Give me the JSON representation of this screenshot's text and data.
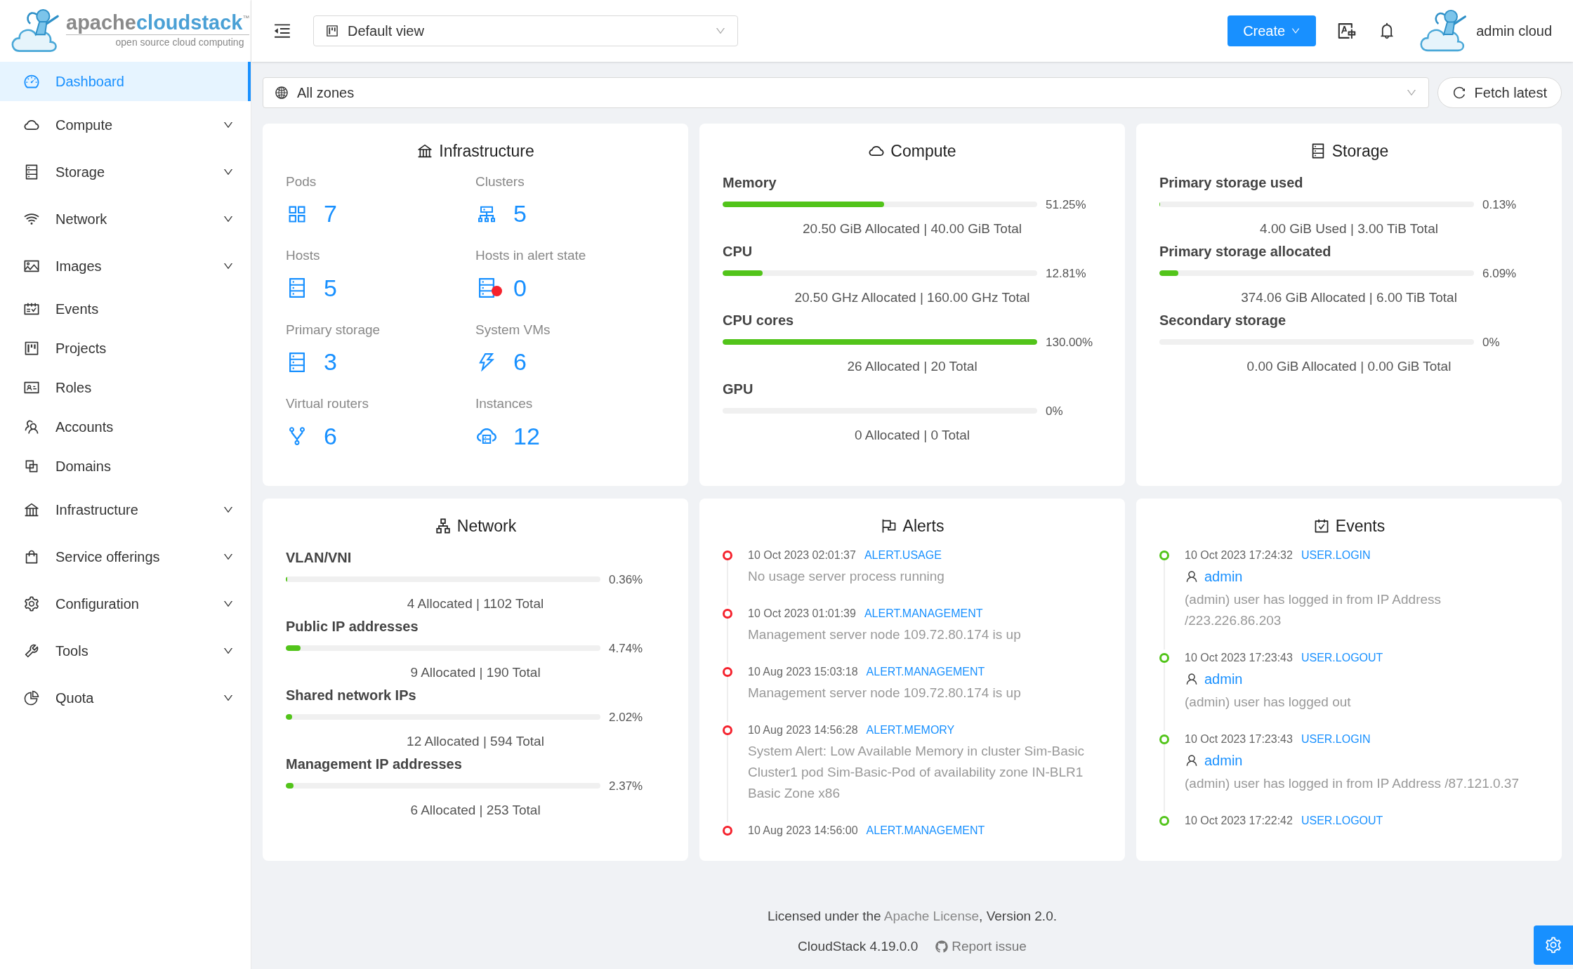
{
  "logo": {
    "part_1": "apache",
    "part_2": "cloudstack",
    "trademark": "™",
    "tagline": "open source cloud computing"
  },
  "header": {
    "view_select": "Default view",
    "create_button": "Create",
    "user": "admin cloud"
  },
  "sidebar": {
    "items": [
      {
        "label": "Dashboard",
        "selected": true,
        "expandable": false
      },
      {
        "label": "Compute",
        "selected": false,
        "expandable": true
      },
      {
        "label": "Storage",
        "selected": false,
        "expandable": true
      },
      {
        "label": "Network",
        "selected": false,
        "expandable": true
      },
      {
        "label": "Images",
        "selected": false,
        "expandable": true
      },
      {
        "label": "Events",
        "selected": false,
        "expandable": false
      },
      {
        "label": "Projects",
        "selected": false,
        "expandable": false
      },
      {
        "label": "Roles",
        "selected": false,
        "expandable": false
      },
      {
        "label": "Accounts",
        "selected": false,
        "expandable": false
      },
      {
        "label": "Domains",
        "selected": false,
        "expandable": false
      },
      {
        "label": "Infrastructure",
        "selected": false,
        "expandable": true
      },
      {
        "label": "Service offerings",
        "selected": false,
        "expandable": true
      },
      {
        "label": "Configuration",
        "selected": false,
        "expandable": true
      },
      {
        "label": "Tools",
        "selected": false,
        "expandable": true
      },
      {
        "label": "Quota",
        "selected": false,
        "expandable": true
      }
    ]
  },
  "zone_select": "All zones",
  "fetch_button": "Fetch latest",
  "infrastructure": {
    "title": "Infrastructure",
    "stats": [
      {
        "label": "Pods",
        "value": "7",
        "alert": false
      },
      {
        "label": "Clusters",
        "value": "5",
        "alert": false
      },
      {
        "label": "Hosts",
        "value": "5",
        "alert": false
      },
      {
        "label": "Hosts in alert state",
        "value": "0",
        "alert": true
      },
      {
        "label": "Primary storage",
        "value": "3",
        "alert": false
      },
      {
        "label": "System VMs",
        "value": "6",
        "alert": false
      },
      {
        "label": "Virtual routers",
        "value": "6",
        "alert": false
      },
      {
        "label": "Instances",
        "value": "12",
        "alert": false
      }
    ]
  },
  "compute": {
    "title": "Compute",
    "meters": [
      {
        "name": "Memory",
        "level": 0.5125,
        "reading": "51.25%",
        "detail": "20.50 GiB Allocated | 40.00 GiB Total"
      },
      {
        "name": "CPU",
        "level": 0.1281,
        "reading": "12.81%",
        "detail": "20.50 GHz Allocated | 160.00 GHz Total"
      },
      {
        "name": "CPU cores",
        "level": 1,
        "reading": "130.00%",
        "detail": "26 Allocated | 20 Total"
      },
      {
        "name": "GPU",
        "level": 0,
        "reading": "0%",
        "detail": "0 Allocated | 0 Total"
      }
    ]
  },
  "storage": {
    "title": "Storage",
    "meters": [
      {
        "name": "Primary storage used",
        "level": 0.0013,
        "reading": "0.13%",
        "detail": "4.00 GiB Used | 3.00 TiB Total"
      },
      {
        "name": "Primary storage allocated",
        "level": 0.0609,
        "reading": "6.09%",
        "detail": "374.06 GiB Allocated | 6.00 TiB Total"
      },
      {
        "name": "Secondary storage",
        "level": 0,
        "reading": "0%",
        "detail": "0.00 GiB Allocated | 0.00 GiB Total"
      }
    ]
  },
  "network": {
    "title": "Network",
    "meters": [
      {
        "name": "VLAN/VNI",
        "level": 0.0036,
        "reading": "0.36%",
        "detail": "4 Allocated | 1102 Total"
      },
      {
        "name": "Public IP addresses",
        "level": 0.0474,
        "reading": "4.74%",
        "detail": "9 Allocated | 190 Total"
      },
      {
        "name": "Shared network IPs",
        "level": 0.0202,
        "reading": "2.02%",
        "detail": "12 Allocated | 594 Total"
      },
      {
        "name": "Management IP addresses",
        "level": 0.0237,
        "reading": "2.37%",
        "detail": "6 Allocated | 253 Total"
      }
    ]
  },
  "alerts": {
    "title": "Alerts",
    "items": [
      {
        "time": "10 Oct 2023 02:01:37",
        "type": "ALERT.USAGE",
        "message": "No usage server process running"
      },
      {
        "time": "10 Oct 2023 01:01:39",
        "type": "ALERT.MANAGEMENT",
        "message": "Management server node 109.72.80.174 is up"
      },
      {
        "time": "10 Aug 2023 15:03:18",
        "type": "ALERT.MANAGEMENT",
        "message": "Management server node 109.72.80.174 is up"
      },
      {
        "time": "10 Aug 2023 14:56:28",
        "type": "ALERT.MEMORY",
        "message": "System Alert: Low Available Memory in cluster Sim-Basic Cluster1 pod Sim-Basic-Pod of availability zone IN-BLR1 Basic Zone x86"
      },
      {
        "time": "10 Aug 2023 14:56:00",
        "type": "ALERT.MANAGEMENT"
      }
    ]
  },
  "events": {
    "title": "Events",
    "items": [
      {
        "time": "10 Oct 2023 17:24:32",
        "type": "USER.LOGIN",
        "user": "admin",
        "message": "(admin) user has logged in from IP Address /223.226.86.203"
      },
      {
        "time": "10 Oct 2023 17:23:43",
        "type": "USER.LOGOUT",
        "user": "admin",
        "message": "(admin) user has logged out"
      },
      {
        "time": "10 Oct 2023 17:23:43",
        "type": "USER.LOGIN",
        "user": "admin",
        "message": "(admin) user has logged in from IP Address /87.121.0.37"
      },
      {
        "time": "10 Oct 2023 17:22:42",
        "type": "USER.LOGOUT"
      }
    ]
  },
  "footer": {
    "license_before": "Licensed under the ",
    "license_link": "Apache License",
    "license_after": ", Version 2.0.",
    "version": "CloudStack 4.19.0.0",
    "report_link": "Report issue"
  }
}
